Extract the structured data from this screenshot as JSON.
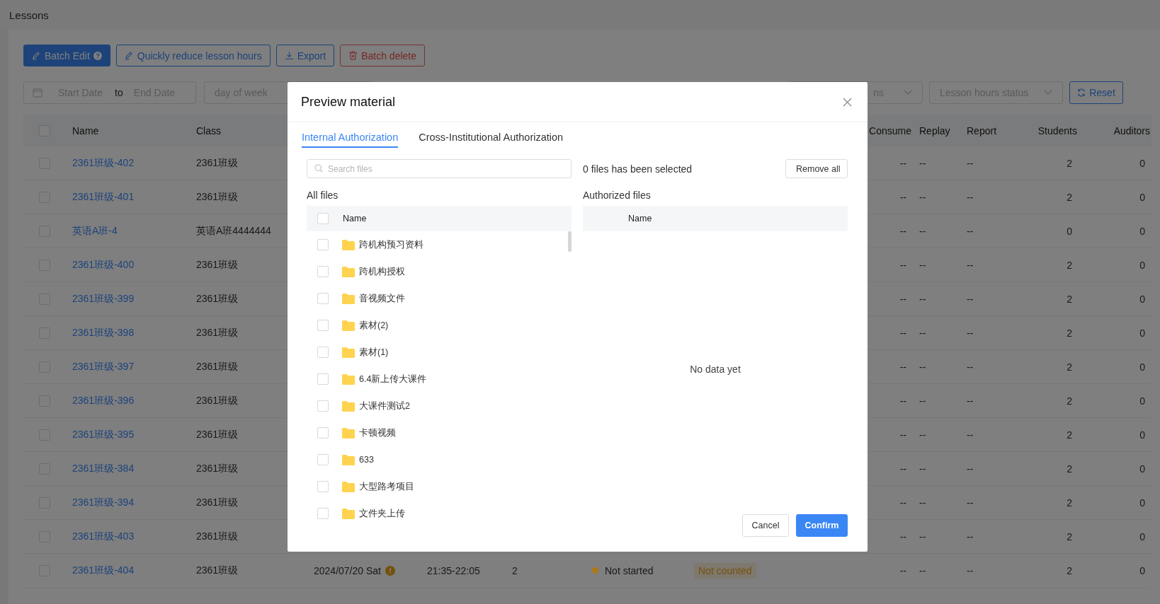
{
  "page": {
    "title": "Lessons"
  },
  "toolbar": {
    "buttons": [
      {
        "label": "Batch Edit",
        "kind": "primary"
      },
      {
        "label": "Quickly reduce lesson hours",
        "kind": "outline"
      },
      {
        "label": "Export",
        "kind": "outline"
      },
      {
        "label": "Batch delete",
        "kind": "danger"
      }
    ]
  },
  "filters": {
    "start_placeholder": "Start Date",
    "separator": "to",
    "end_placeholder": "End Date",
    "day_placeholder": "day of week",
    "select_3": {
      "placeholder": "ns"
    },
    "hours_placeholder": "Lesson hours status",
    "reset": "Reset"
  },
  "table": {
    "header_checked": false,
    "columns": [
      "Name",
      "Class",
      "Consume",
      "Replay",
      "Report",
      "Students",
      "Auditors"
    ],
    "rows": [
      {
        "checked": false,
        "name": "2361班级-402",
        "class": "2361班级",
        "consume": "--",
        "replay": "--",
        "report": "--",
        "students": "2",
        "auditors": "0"
      },
      {
        "checked": false,
        "name": "2361班级-401",
        "class": "2361班级",
        "consume": "--",
        "replay": "--",
        "report": "--",
        "students": "2",
        "auditors": "0"
      },
      {
        "checked": false,
        "name": "英语A班-4",
        "class": "英语A班4444444",
        "consume": "--",
        "replay": "--",
        "report": "--",
        "students": "0",
        "auditors": "0"
      },
      {
        "checked": false,
        "name": "2361班级-400",
        "class": "2361班级",
        "consume": "--",
        "replay": "--",
        "report": "--",
        "students": "2",
        "auditors": "0"
      },
      {
        "checked": false,
        "name": "2361班级-399",
        "class": "2361班级",
        "consume": "--",
        "replay": "--",
        "report": "--",
        "students": "2",
        "auditors": "0"
      },
      {
        "checked": false,
        "name": "2361班级-398",
        "class": "2361班级",
        "consume": "--",
        "replay": "--",
        "report": "--",
        "students": "2",
        "auditors": "0"
      },
      {
        "checked": false,
        "name": "2361班级-397",
        "class": "2361班级",
        "consume": "--",
        "replay": "--",
        "report": "--",
        "students": "2",
        "auditors": "0"
      },
      {
        "checked": false,
        "name": "2361班级-396",
        "class": "2361班级",
        "consume": "--",
        "replay": "--",
        "report": "--",
        "students": "2",
        "auditors": "0"
      },
      {
        "checked": false,
        "name": "2361班级-395",
        "class": "2361班级",
        "consume": "--",
        "replay": "--",
        "report": "--",
        "students": "2",
        "auditors": "0"
      },
      {
        "checked": false,
        "name": "2361班级-384",
        "class": "2361班级",
        "consume": "--",
        "replay": "--",
        "report": "--",
        "students": "2",
        "auditors": "0"
      },
      {
        "checked": false,
        "name": "2361班级-394",
        "class": "2361班级",
        "consume": "--",
        "replay": "--",
        "report": "--",
        "students": "2",
        "auditors": "0"
      },
      {
        "checked": false,
        "name": "2361班级-403",
        "class": "2361班级",
        "consume": "--",
        "replay": "--",
        "report": "--",
        "students": "2",
        "auditors": "0"
      },
      {
        "checked": false,
        "name": "2361班级-404",
        "class": "2361班级",
        "date": {
          "text": "2024/07/20 Sat",
          "warning": true
        },
        "time": "21:35-22:05",
        "count": "2",
        "status": {
          "label": "Not started",
          "color": "#b07812"
        },
        "hours_status": "Not counted",
        "consume": "--",
        "replay": "--",
        "report": "--",
        "students": "2",
        "auditors": "0"
      }
    ]
  },
  "modal": {
    "title": "Preview material",
    "tabs": [
      {
        "label": "Internal Authorization",
        "selected": true
      },
      {
        "label": "Cross-Institutional Authorization",
        "selected": false
      }
    ],
    "search": {
      "placeholder": "Search files"
    },
    "selected_count": "0 files has been selected",
    "remove_all": "Remove all",
    "all_files": {
      "title": "All files",
      "header": "Name",
      "header_checked": false,
      "items": [
        {
          "name": "跨机构预习资料",
          "checked": false
        },
        {
          "name": "跨机构授权",
          "checked": false
        },
        {
          "name": "音视频文件",
          "checked": false
        },
        {
          "name": "素材(2)",
          "checked": false
        },
        {
          "name": "素材(1)",
          "checked": false
        },
        {
          "name": "6.4新上传大课件",
          "checked": false
        },
        {
          "name": "大课件测试2",
          "checked": false
        },
        {
          "name": "卡顿视频",
          "checked": false
        },
        {
          "name": "633",
          "checked": false
        },
        {
          "name": "大型路考项目",
          "checked": false
        },
        {
          "name": "文件夹上传",
          "checked": false
        }
      ]
    },
    "authorized_files": {
      "title": "Authorized files",
      "header": "Name",
      "empty": "No data yet"
    },
    "buttons": [
      {
        "label": "Cancel",
        "kind": "default"
      },
      {
        "label": "Confirm",
        "kind": "primary"
      }
    ]
  }
}
